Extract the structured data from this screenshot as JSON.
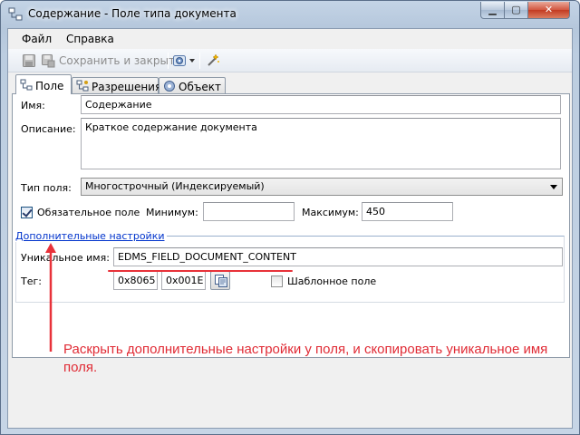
{
  "window": {
    "title": "Содержание - Поле типа документа",
    "controls": {
      "minimize": "▁",
      "maximize": "▢",
      "close": "✕"
    }
  },
  "menu": {
    "file": "Файл",
    "help": "Справка"
  },
  "toolbar": {
    "save_close_label": "Сохранить и закрыть",
    "icons": [
      "save-icon",
      "save-close-icon",
      "print-icon",
      "wand-icon"
    ]
  },
  "tabs": [
    {
      "label": "Поле",
      "icon": "field-icon",
      "active": true
    },
    {
      "label": "Разрешения",
      "icon": "permissions-icon",
      "active": false
    },
    {
      "label": "Объект",
      "icon": "object-icon",
      "active": false
    }
  ],
  "form": {
    "name_label": "Имя:",
    "name_value": "Содержание",
    "description_label": "Описание:",
    "description_value": "Краткое содержание документа",
    "type_label": "Тип поля:",
    "type_value": "Многострочный (Индексируемый)",
    "required_label": "Обязательное поле",
    "required_checked": true,
    "min_label": "Минимум:",
    "min_value": "",
    "max_label": "Максимум:",
    "max_value": "450"
  },
  "advanced": {
    "link_label": "Дополнительные настройки",
    "unique_name_label": "Уникальное имя:",
    "unique_name_value": "EDMS_FIELD_DOCUMENT_CONTENT",
    "tag_label": "Тег:",
    "tag_value_1": "0x8065",
    "tag_value_2": "0x001E",
    "template_label": "Шаблонное поле",
    "template_checked": false
  },
  "annotation": {
    "text": "Раскрыть дополнительные настройки у поля, и скопировать уникальное имя поля.",
    "color": "#e02b35"
  }
}
